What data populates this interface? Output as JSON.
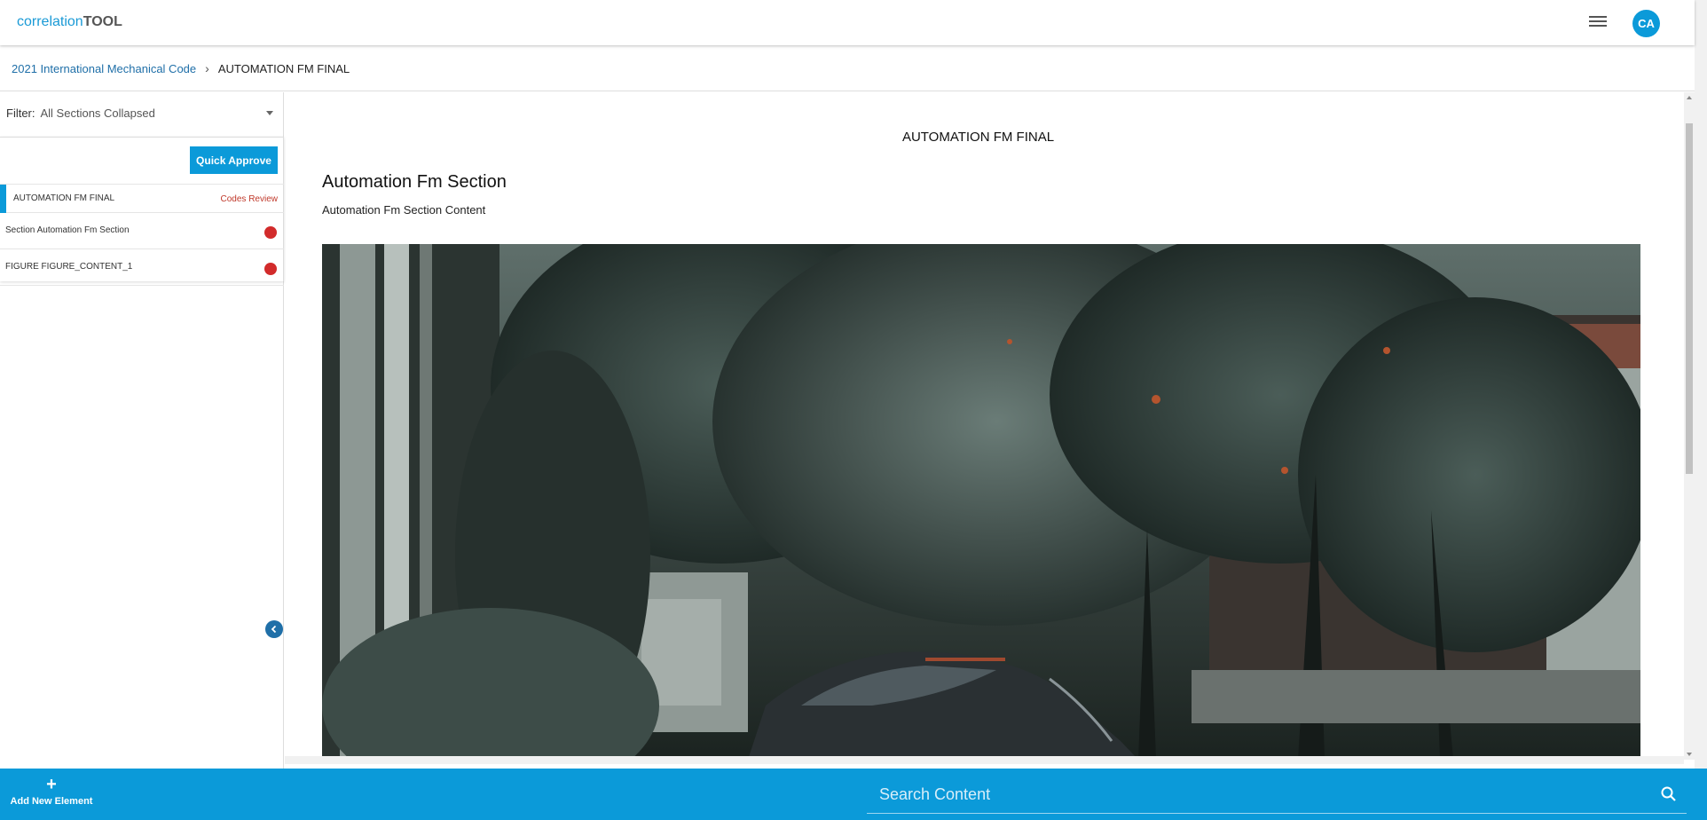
{
  "header": {
    "logo_part1": "correlation",
    "logo_part2": "TOOL",
    "avatar_initials": "CA"
  },
  "breadcrumb": {
    "parent": "2021 International Mechanical Code",
    "current": "AUTOMATION FM FINAL"
  },
  "sidebar": {
    "filter_label": "Filter:",
    "filter_value": "All Sections Collapsed",
    "quick_approve_label": "Quick Approve",
    "items": [
      {
        "label": "AUTOMATION FM FINAL",
        "status": "Codes Review"
      },
      {
        "label": "Section Automation Fm Section",
        "status_color": "#d22b2b"
      },
      {
        "label": "FIGURE FIGURE_CONTENT_1",
        "status_color": "#d22b2b"
      }
    ]
  },
  "main": {
    "doc_title": "AUTOMATION FM FINAL",
    "section_heading": "Automation Fm Section",
    "section_content": "Automation Fm Section Content",
    "figure_alt": "garden-car-photo"
  },
  "footer": {
    "add_label": "Add New Element",
    "search_placeholder": "Search Content"
  },
  "colors": {
    "accent": "#0b9ad9",
    "link": "#1f6fa8",
    "status_red": "#d22b2b"
  }
}
